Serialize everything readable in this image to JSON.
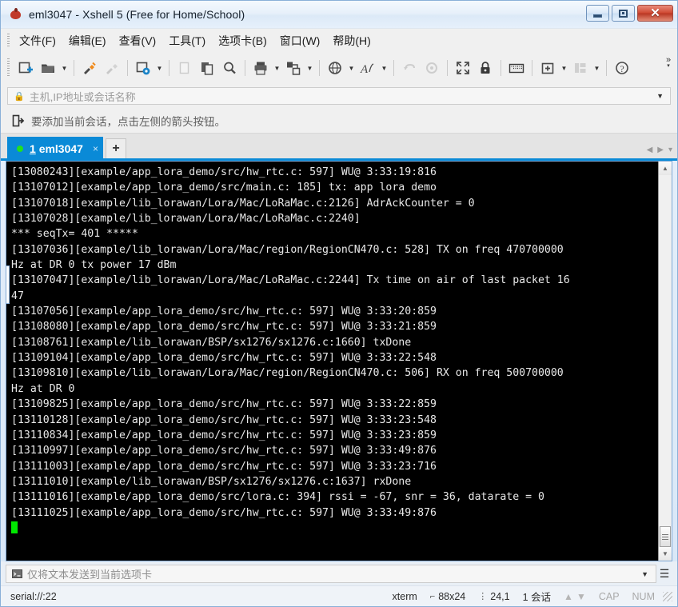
{
  "window": {
    "title": "eml3047 - Xshell 5 (Free for Home/School)",
    "app_icon": "bug-icon",
    "buttons": {
      "minimize": "minimize-button",
      "maximize": "maximize-button",
      "close": "close-button"
    }
  },
  "menubar": {
    "items": [
      {
        "label": "文件(F)",
        "name": "menu-file"
      },
      {
        "label": "编辑(E)",
        "name": "menu-edit"
      },
      {
        "label": "查看(V)",
        "name": "menu-view"
      },
      {
        "label": "工具(T)",
        "name": "menu-tools"
      },
      {
        "label": "选项卡(B)",
        "name": "menu-tabs"
      },
      {
        "label": "窗口(W)",
        "name": "menu-window"
      },
      {
        "label": "帮助(H)",
        "name": "menu-help"
      }
    ]
  },
  "toolbar": {
    "overflow_label": "»",
    "buttons": [
      {
        "name": "new-session-icon",
        "enabled": true
      },
      {
        "name": "open-folder-icon",
        "enabled": true
      },
      {
        "name": "reconnect-icon",
        "enabled": true
      },
      {
        "name": "disconnect-icon",
        "enabled": false
      },
      {
        "name": "session-properties-icon",
        "enabled": true
      },
      {
        "name": "copy-icon",
        "enabled": false
      },
      {
        "name": "paste-icon",
        "enabled": true
      },
      {
        "name": "find-icon",
        "enabled": true
      },
      {
        "name": "print-icon",
        "enabled": true
      },
      {
        "name": "transfer-icon",
        "enabled": true
      },
      {
        "name": "globe-icon",
        "enabled": true
      },
      {
        "name": "font-icon",
        "enabled": true
      },
      {
        "name": "undo-icon",
        "enabled": false
      },
      {
        "name": "redo-icon",
        "enabled": false
      },
      {
        "name": "fullscreen-icon",
        "enabled": true
      },
      {
        "name": "lock-icon",
        "enabled": true
      },
      {
        "name": "keyboard-icon",
        "enabled": true
      },
      {
        "name": "new-pane-icon",
        "enabled": true
      },
      {
        "name": "layout-icon",
        "enabled": false
      },
      {
        "name": "help-icon",
        "enabled": true
      }
    ]
  },
  "address_bar": {
    "placeholder": "主机,IP地址或会话名称",
    "value": "",
    "lock_icon": "lock-icon",
    "dropdown_icon": "chevron-down-icon"
  },
  "hint_bar": {
    "icon": "add-session-arrow-icon",
    "text": "要添加当前会话，点击左侧的箭头按钮。"
  },
  "tabbar": {
    "active_tab": {
      "number": "1",
      "name": "eml3047",
      "status_dot_color": "#22e01f",
      "close_label": "×"
    },
    "add_tab_label": "+",
    "nav_prev": "◀",
    "nav_next": "▶",
    "nav_menu": "▾"
  },
  "terminal": {
    "bg_color": "#000000",
    "fg_color": "#e8e8e8",
    "cursor_color": "#00e800",
    "lines": [
      "[13080243][example/app_lora_demo/src/hw_rtc.c: 597] WU@ 3:33:19:816",
      "[13107012][example/app_lora_demo/src/main.c: 185] tx: app lora demo",
      "[13107018][example/lib_lorawan/Lora/Mac/LoRaMac.c:2126] AdrAckCounter = 0",
      "[13107028][example/lib_lorawan/Lora/Mac/LoRaMac.c:2240]",
      "*** seqTx= 401 *****",
      "[13107036][example/lib_lorawan/Lora/Mac/region/RegionCN470.c: 528] TX on freq 470700000",
      "Hz at DR 0 tx power 17 dBm",
      "[13107047][example/lib_lorawan/Lora/Mac/LoRaMac.c:2244] Tx time on air of last packet 16",
      "47",
      "[13107056][example/app_lora_demo/src/hw_rtc.c: 597] WU@ 3:33:20:859",
      "[13108080][example/app_lora_demo/src/hw_rtc.c: 597] WU@ 3:33:21:859",
      "[13108761][example/lib_lorawan/BSP/sx1276/sx1276.c:1660] txDone",
      "[13109104][example/app_lora_demo/src/hw_rtc.c: 597] WU@ 3:33:22:548",
      "[13109810][example/lib_lorawan/Lora/Mac/region/RegionCN470.c: 506] RX on freq 500700000",
      "Hz at DR 0",
      "[13109825][example/app_lora_demo/src/hw_rtc.c: 597] WU@ 3:33:22:859",
      "[13110128][example/app_lora_demo/src/hw_rtc.c: 597] WU@ 3:33:23:548",
      "[13110834][example/app_lora_demo/src/hw_rtc.c: 597] WU@ 3:33:23:859",
      "[13110997][example/app_lora_demo/src/hw_rtc.c: 597] WU@ 3:33:49:876",
      "[13111003][example/app_lora_demo/src/hw_rtc.c: 597] WU@ 3:33:23:716",
      "[13111010][example/lib_lorawan/BSP/sx1276/sx1276.c:1637] rxDone",
      "[13111016][example/app_lora_demo/src/lora.c: 394] rssi = -67, snr = 36, datarate = 0",
      "[13111025][example/app_lora_demo/src/hw_rtc.c: 597] WU@ 3:33:49:876"
    ],
    "scrollbar": {
      "up_arrow": "▲",
      "down_arrow": "▼"
    }
  },
  "send_bar": {
    "icon": "command-prompt-icon",
    "placeholder": "仅将文本发送到当前选项卡",
    "value": "",
    "dropdown_icon": "chevron-down-icon",
    "menu_icon": "hamburger-icon"
  },
  "status_bar": {
    "connection": "serial://:22",
    "term_type": "xterm",
    "size": "88x24",
    "cursor_pos": "24,1",
    "sessions": "1 会话",
    "caps": "CAP",
    "num": "NUM",
    "size_icon": "screen-size-icon",
    "cursor_icon": "cursor-pos-icon",
    "up_arrow": "▲",
    "down_arrow": "▼"
  },
  "colors": {
    "accent": "#0a8ad7",
    "terminal_bg": "#000000",
    "cursor": "#00e800",
    "close_button": "#cf4a33"
  }
}
